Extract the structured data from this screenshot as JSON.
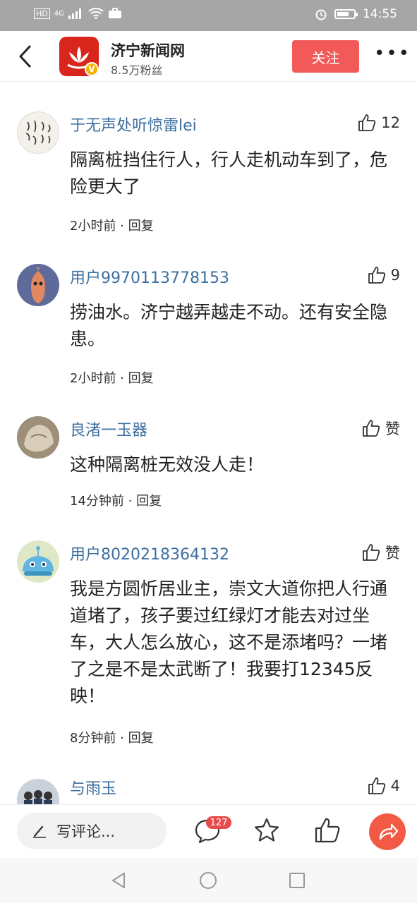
{
  "status_bar": {
    "left": "HD",
    "network": "4G",
    "time": "14:55"
  },
  "header": {
    "account_name": "济宁新闻网",
    "fans": "8.5万粉丝",
    "follow_label": "关注",
    "more_label": "•••",
    "badge_label": "V",
    "brand_color": "#d9261c"
  },
  "comments": [
    {
      "user": "于无声处听惊雷lei",
      "likes": "12",
      "text": "隔离桩挡住行人，行人走机动车到了，危险更大了",
      "time": "2小时前",
      "reply": "回复"
    },
    {
      "user": "用户9970113778153",
      "likes": "9",
      "text": "捞油水。济宁越弄越走不动。还有安全隐患。",
      "time": "2小时前",
      "reply": "回复"
    },
    {
      "user": "良渚一玉器",
      "likes": "赞",
      "text": "这种隔离桩无效没人走！",
      "time": "14分钟前",
      "reply": "回复"
    },
    {
      "user": "用户8020218364132",
      "likes": "赞",
      "text": "我是方圆忻居业主，崇文大道你把人行通道堵了，孩子要过红绿灯才能去对过坐车，大人怎么放心，这不是添堵吗？一堵了之是不是太武断了！我要打12345反映！",
      "time": "8分钟前",
      "reply": "回复"
    },
    {
      "user": "与雨玉",
      "likes": "4"
    }
  ],
  "meta_separator": " · ",
  "action_bar": {
    "write_placeholder": "写评论...",
    "comment_count": "127",
    "accent_color": "#f25a45"
  }
}
